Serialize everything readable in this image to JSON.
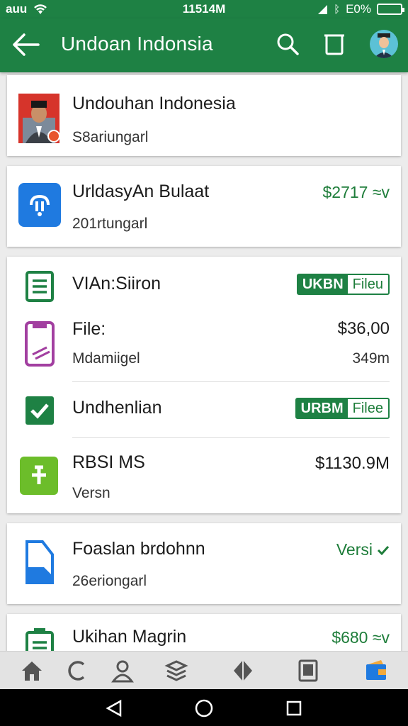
{
  "status_bar": {
    "carrier": "auu",
    "time": "11514M",
    "battery": "E0%"
  },
  "app_bar": {
    "title": "Undoan Indonsia"
  },
  "cards": {
    "c1": {
      "title": "Undouhan Indonesia",
      "subtitle": "S8ariungarl"
    },
    "c2": {
      "title": "UrldasуAn Bulaat",
      "subtitle": "201rtungarl",
      "amount": "$2717 ≈v"
    },
    "c3": {
      "r1": {
        "title": "VIAn:Siiron",
        "tag_key": "UKBN",
        "tag_val": "Fileu"
      },
      "r2": {
        "title": "File:",
        "subtitle": "Mdamiigel",
        "amount": "$36,00",
        "sub_amount": "349m"
      },
      "r3": {
        "title": "Undhenlian",
        "tag_key": "URBM",
        "tag_val": "Filee"
      },
      "r4": {
        "title": "RBSI MS",
        "subtitle": "Versn",
        "amount": "$1130.9M"
      }
    },
    "c4": {
      "title": "Foaslan brdohnn",
      "subtitle": "26eriongarl",
      "status": "Versi"
    },
    "c5": {
      "title": "Ukihan Magrin",
      "amount": "$680 ≈v"
    }
  },
  "bottom_nav": [
    "home-icon",
    "refresh-icon",
    "profile-icon",
    "layers-icon",
    "diamond-icon",
    "tablet-icon",
    "wallet-icon"
  ],
  "system_nav": [
    "back-icon",
    "home-icon",
    "recents-icon"
  ],
  "colors": {
    "brand": "#1e8144",
    "accent_green": "#1e7d3a",
    "blue": "#1f7ae0",
    "purple": "#a23fa0",
    "lime": "#6cbd2a"
  }
}
